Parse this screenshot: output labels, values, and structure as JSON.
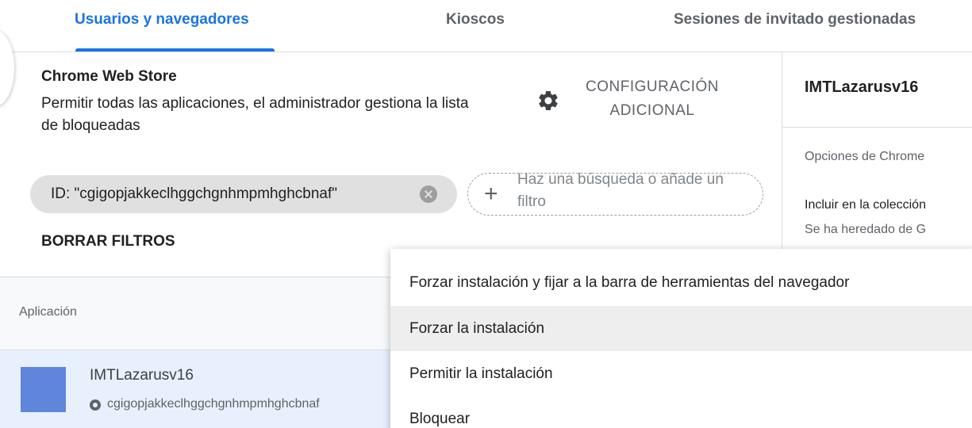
{
  "tabs": [
    {
      "label": "Usuarios y navegadores",
      "active": true
    },
    {
      "label": "Kioscos",
      "active": false
    },
    {
      "label": "Sesiones de invitado gestionadas",
      "active": false
    }
  ],
  "policy": {
    "title": "Chrome Web Store",
    "description": "Permitir todas las aplicaciones, el administrador gestiona la lista de bloqueadas",
    "config_button": "CONFIGURACIÓN ADICIONAL",
    "config_icon": "gear-icon"
  },
  "filter": {
    "chip_label": "ID: \"cgigopjakkeclhggchgnhmpmhghcbnaf\"",
    "add_placeholder": "Haz una búsqueda o añade un filtro",
    "clear_label": "BORRAR FILTROS"
  },
  "table": {
    "column_header": "Aplicación",
    "rows": [
      {
        "name": "IMTLazarusv16",
        "id": "cgigopjakkeclhggchgnhmpmhghcbnaf",
        "icon_color": "#5f86db"
      }
    ]
  },
  "details": {
    "title": "IMTLazarusv16",
    "options_label": "Opciones de Chrome",
    "include_label": "Incluir en la colección",
    "inherited_label": "Se ha heredado de G"
  },
  "menu": {
    "items": [
      "Forzar instalación y fijar a la barra de herramientas del navegador",
      "Forzar la instalación",
      "Permitir la instalación",
      "Bloquear"
    ],
    "highlighted_index": 1
  },
  "colors": {
    "accent": "#1a73e8",
    "selected_row": "#e8f0fe"
  }
}
